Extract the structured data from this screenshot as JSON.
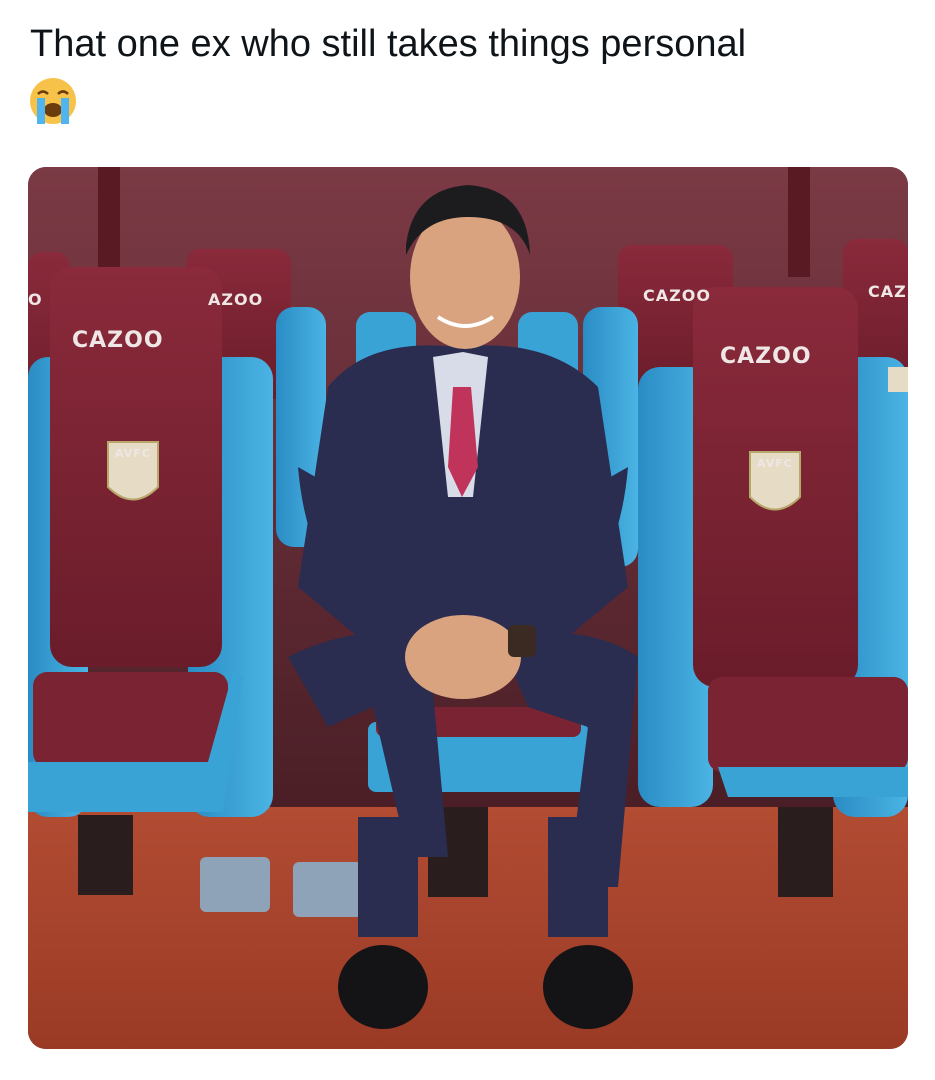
{
  "post": {
    "text": "That one ex who still takes things personal",
    "emoji": "loudly-crying-face"
  },
  "photo": {
    "sponsor_labels": [
      "O",
      "CAZOO",
      "AZOO",
      "CAZOO",
      "CAZOO",
      "CAZ"
    ],
    "crest": "AVFC",
    "colors": {
      "claret": "#7a2333",
      "sky_blue": "#3aa3d6",
      "suit": "#2a2d4f",
      "tie": "#c0335a",
      "turf": "#a9452d"
    }
  }
}
